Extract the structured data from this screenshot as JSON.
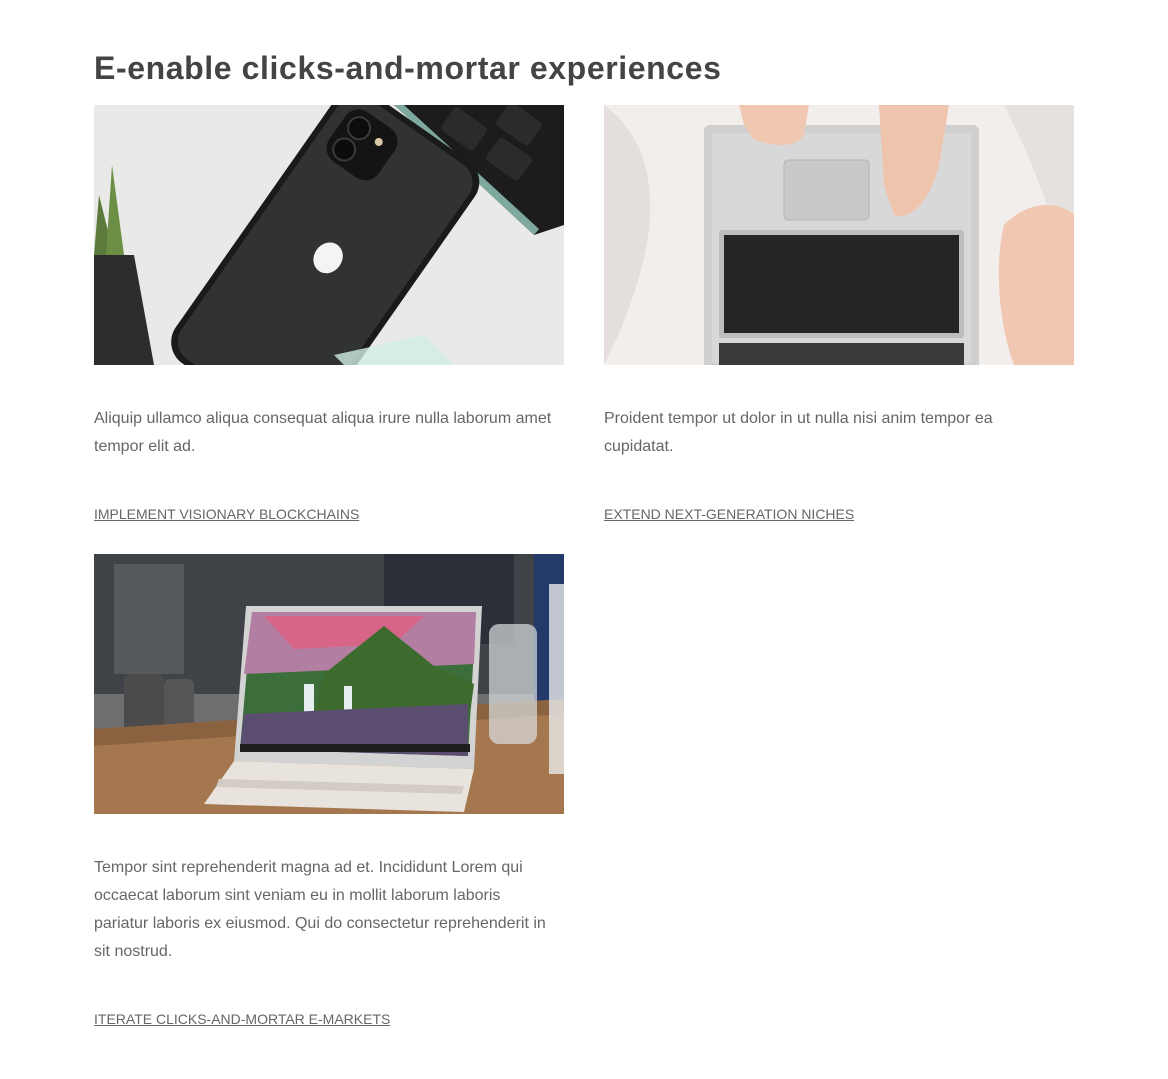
{
  "section": {
    "title": "E-enable clicks-and-mortar experiences"
  },
  "cards": [
    {
      "image_icon": "iphone-and-keyboard-photo",
      "description": "Aliquip ullamco aliqua consequat aliqua irure nulla laborum amet tempor elit ad.",
      "link": "IMPLEMENT VISIONARY BLOCKCHAINS"
    },
    {
      "image_icon": "hands-on-laptop-photo",
      "description": "Proident tempor ut dolor in ut nulla nisi anim tempor ea cupidatat.",
      "link": "EXTEND NEXT-GENERATION NICHES"
    },
    {
      "image_icon": "laptop-waterfall-wallpaper-photo",
      "description": "Tempor sint reprehenderit magna ad et. Incididunt Lorem qui occaecat laborum sint veniam eu in mollit laborum laboris pariatur laboris ex eiusmod. Qui do consectetur reprehenderit in sit nostrud.",
      "link": "ITERATE CLICKS-AND-MORTAR E-MARKETS"
    }
  ],
  "colors": {
    "title": "#444444",
    "body_text": "#666666",
    "background": "#ffffff"
  }
}
